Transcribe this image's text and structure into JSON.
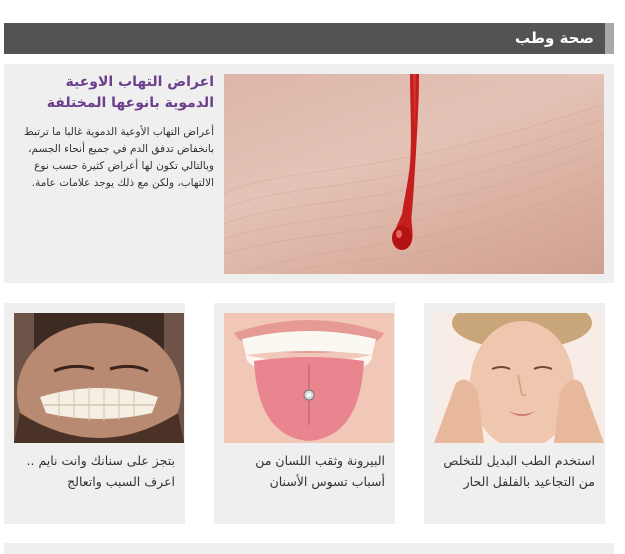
{
  "section": {
    "title": "صحة وطب"
  },
  "featured": {
    "headline": "اعراض التهاب الاوعية الدموية بانوعها المختلفة",
    "excerpt": "أعراض التهاب الأوعية الدموية غالبا ما ترتبط بانخفاض تدفق الدم في جميع أنحاء الجسم، وبالتالي تكون لها أعراض كثيرة حسب نوع الالتهاب، ولكن مع ذلك يوجد علامات عامة.",
    "image": "blood-drop-on-skin"
  },
  "cards": [
    {
      "caption": "استخدم الطب البديل للتخلص من التجاعيد بالفلفل الحار",
      "image": "face-massage"
    },
    {
      "caption": "البيرونة وثقب اللسان من أسباب تسوس الأسنان",
      "image": "tongue-piercing"
    },
    {
      "caption": "بتجز على سنانك وانت نايم .. اعرف السبب واتعالج",
      "image": "teeth-clenching"
    }
  ],
  "colors": {
    "header_bg": "#535353",
    "header_stripe": "#a9a9a9",
    "headline": "#6b3f8c",
    "card_bg": "#efefef"
  }
}
